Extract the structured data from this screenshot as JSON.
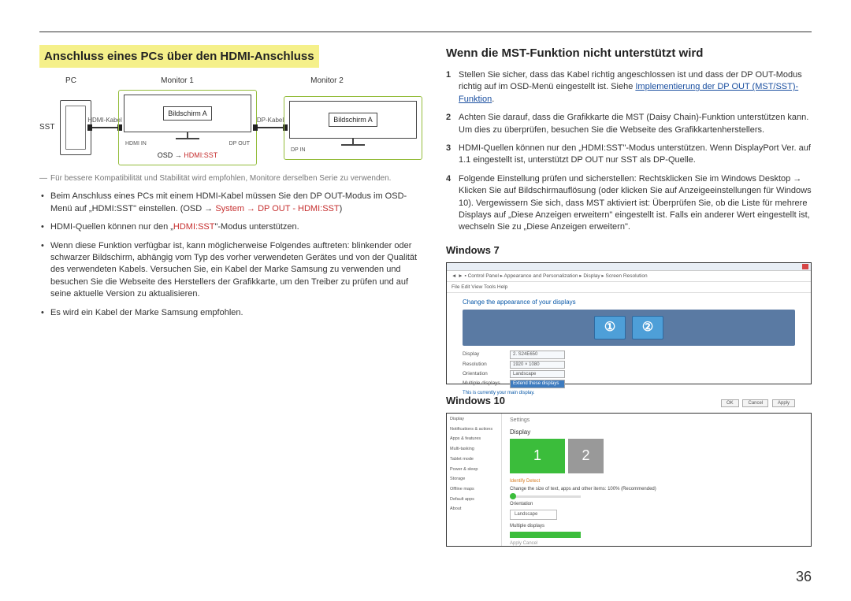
{
  "left": {
    "heading": "Anschluss eines PCs über den HDMI-Anschluss",
    "diagram": {
      "pc": "PC",
      "monitor1": "Monitor 1",
      "monitor2": "Monitor 2",
      "sst": "SST",
      "hdmi_cable": "HDMI-Kabel",
      "dp_cable": "DP-Kabel",
      "screen_a": "Bildschirm A",
      "screen_a2": "Bildschirm A",
      "port_hdmi_in": "HDMI IN",
      "port_dp_out": "DP OUT",
      "port_dp_in": "DP IN",
      "osd_prefix": "OSD → ",
      "osd_target": "HDMI:SST"
    },
    "footnote": "Für bessere Kompatibilität und Stabilität wird empfohlen, Monitore derselben Serie zu verwenden.",
    "bullets": [
      {
        "pre": "Beim Anschluss eines PCs mit einem HDMI-Kabel müssen Sie den DP OUT-Modus im OSD-Menü auf „HDMI:SST\" einstellen. (OSD → ",
        "red": "System → DP OUT - HDMI:SST",
        "post": ")"
      },
      {
        "pre": "HDMI-Quellen können nur den „",
        "red": "HDMI:SST",
        "post": "\"-Modus unterstützen."
      },
      {
        "pre": "Wenn diese Funktion verfügbar ist, kann möglicherweise Folgendes auftreten: blinkender oder schwarzer Bildschirm, abhängig vom Typ des vorher verwendeten Gerätes und von der Qualität des verwendeten Kabels. Versuchen Sie, ein Kabel der Marke Samsung zu verwenden und besuchen Sie die Webseite des Herstellers der Grafikkarte, um den Treiber zu prüfen und auf seine aktuelle Version zu aktualisieren.",
        "red": "",
        "post": ""
      },
      {
        "pre": "Es wird ein Kabel der Marke Samsung empfohlen.",
        "red": "",
        "post": ""
      }
    ]
  },
  "right": {
    "heading": "Wenn die MST-Funktion nicht unterstützt wird",
    "items": [
      {
        "n": "1",
        "pre": "Stellen Sie sicher, dass das Kabel richtig angeschlossen ist und dass der DP OUT-Modus richtig auf im OSD-Menü eingestellt ist. Siehe ",
        "link": "Implementierung der DP OUT (MST/SST)-Funktion",
        "post": "."
      },
      {
        "n": "2",
        "pre": "Achten Sie darauf, dass die Grafikkarte die MST (Daisy Chain)-Funktion unterstützen kann. Um dies zu überprüfen, besuchen Sie die Webseite des Grafikkartenherstellers.",
        "link": "",
        "post": ""
      },
      {
        "n": "3",
        "pre": "HDMI-Quellen können nur den „HDMI:SST\"-Modus unterstützen. Wenn DisplayPort Ver. auf 1.1 eingestellt ist, unterstützt DP OUT nur SST als DP-Quelle.",
        "link": "",
        "post": ""
      },
      {
        "n": "4",
        "pre": "Folgende Einstellung prüfen und sicherstellen: Rechtsklicken Sie im Windows Desktop → Klicken Sie auf Bildschirmauflösung (oder klicken Sie auf Anzeigeeinstellungen für Windows 10). Vergewissern Sie sich, dass MST aktiviert ist: Überprüfen Sie, ob die Liste für mehrere Displays auf „Diese Anzeigen erweitern\" eingestellt ist. Falls ein anderer Wert eingestellt ist, wechseln Sie zu „Diese Anzeigen erweitern\".",
        "link": "",
        "post": ""
      }
    ],
    "win7_label": "Windows 7",
    "win10_label": "Windows 10",
    "win7": {
      "title": "Change the appearance of your displays",
      "display": "Display",
      "display_v": "2. S24E650",
      "resolution": "Resolution",
      "resolution_v": "1920 × 1080",
      "orientation": "Orientation",
      "orientation_v": "Landscape",
      "multi": "Multiple displays",
      "multi_v": "Extend these displays",
      "note": "This is currently your main display.",
      "ok": "OK",
      "cancel": "Cancel",
      "apply": "Apply"
    },
    "win10": {
      "top": "Settings",
      "head": "Display",
      "side": [
        "Display",
        "Notifications & actions",
        "Apps & features",
        "Multi-tasking",
        "Tablet mode",
        "Power & sleep",
        "Storage",
        "Offline maps",
        "Default apps",
        "About"
      ],
      "orange1": "Identify    Detect",
      "sub1": "Change the size of text, apps and other items: 100% (Recommended)",
      "sub2": "Orientation",
      "drop1": "Landscape",
      "sub3": "Multiple displays",
      "sub4": "Apply    Cancel"
    }
  },
  "page_num": "36"
}
